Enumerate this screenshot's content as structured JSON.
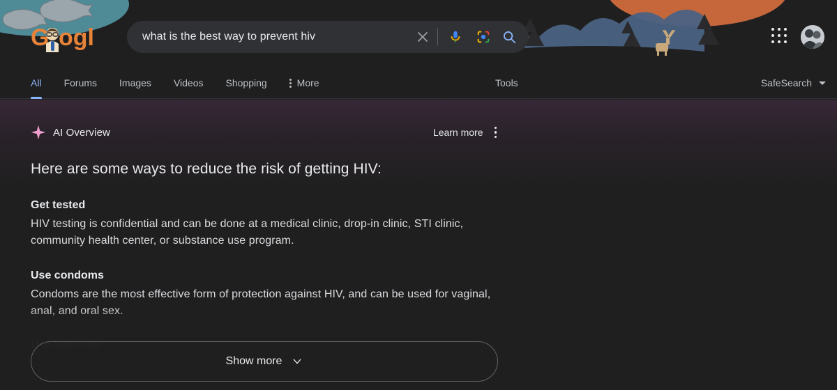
{
  "colors": {
    "page_bg": "#1f1f1f",
    "searchbar_bg": "#303134",
    "active_tab": "#8ab4f8",
    "text_primary": "#e8eaed",
    "text_secondary": "#bdc1c6",
    "ai_sparkle": "#f09fd0",
    "ai_tint": "#5c365a",
    "doodle_orange": "#e8833a",
    "doodle_water": "#4f8b97",
    "banner_forest": "#4a6283",
    "banner_sun": "#c5673a"
  },
  "header": {
    "logo_alt": "Google Doodle logo",
    "search": {
      "query": "what is the best way to prevent hiv",
      "placeholder": "Search",
      "clear_label": "Clear",
      "voice_label": "Search by voice",
      "lens_label": "Search by image",
      "submit_label": "Google Search"
    },
    "apps_label": "Google apps",
    "account_label": "Google Account"
  },
  "nav": {
    "tabs": [
      {
        "label": "All",
        "active": true
      },
      {
        "label": "Forums",
        "active": false
      },
      {
        "label": "Images",
        "active": false
      },
      {
        "label": "Videos",
        "active": false
      },
      {
        "label": "Shopping",
        "active": false
      },
      {
        "label": "More",
        "active": false
      }
    ],
    "tools_label": "Tools",
    "safesearch_label": "SafeSearch"
  },
  "ai_overview": {
    "title": "AI Overview",
    "learn_more": "Learn more",
    "menu_label": "More options",
    "lead": "Here are some ways to reduce the risk of getting HIV:",
    "sections": [
      {
        "heading": "Get tested",
        "body": "HIV testing is confidential and can be done at a medical clinic, drop-in clinic, STI clinic, community health center, or substance use program."
      },
      {
        "heading": "Use condoms",
        "body": "Condoms are the most effective form of protection against HIV, and can be used for vaginal, anal, and oral sex."
      }
    ],
    "faded_heading": "Use lubricant",
    "show_more": "Show more"
  }
}
